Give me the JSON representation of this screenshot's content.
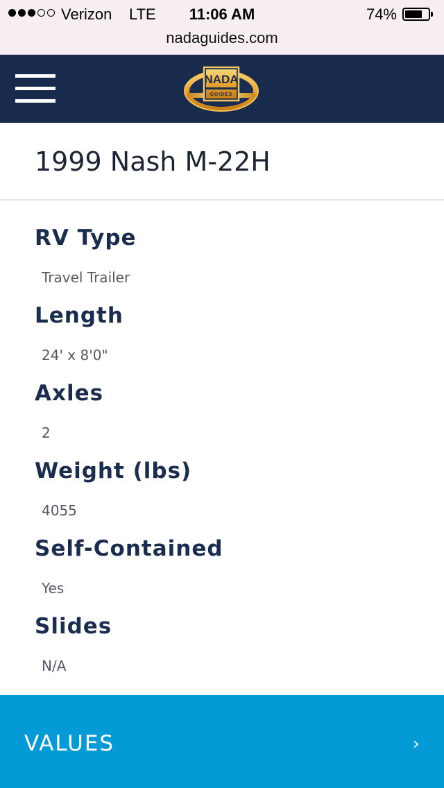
{
  "status_bar": {
    "carrier": "Verizon",
    "network": "LTE",
    "time": "11:06 AM",
    "battery_percent": "74%",
    "battery_level": 0.74,
    "signal_strength": 3,
    "signal_max": 5
  },
  "browser": {
    "url": "nadaguides.com"
  },
  "header": {
    "menu_icon": "hamburger-menu-icon",
    "logo_line1": "NADA",
    "logo_line2": "GUIDES",
    "background": "#192b4d"
  },
  "page": {
    "title": "1999 Nash M-22H"
  },
  "specs": [
    {
      "label": "RV Type",
      "value": "Travel Trailer"
    },
    {
      "label": "Length",
      "value": "24' x 8'0\""
    },
    {
      "label": "Axles",
      "value": "2"
    },
    {
      "label": "Weight (lbs)",
      "value": "4055"
    },
    {
      "label": "Self-Contained",
      "value": "Yes"
    },
    {
      "label": "Slides",
      "value": "N/A"
    }
  ],
  "values_section": {
    "label": "VALUES",
    "chevron": "›",
    "background": "#049ad6"
  }
}
